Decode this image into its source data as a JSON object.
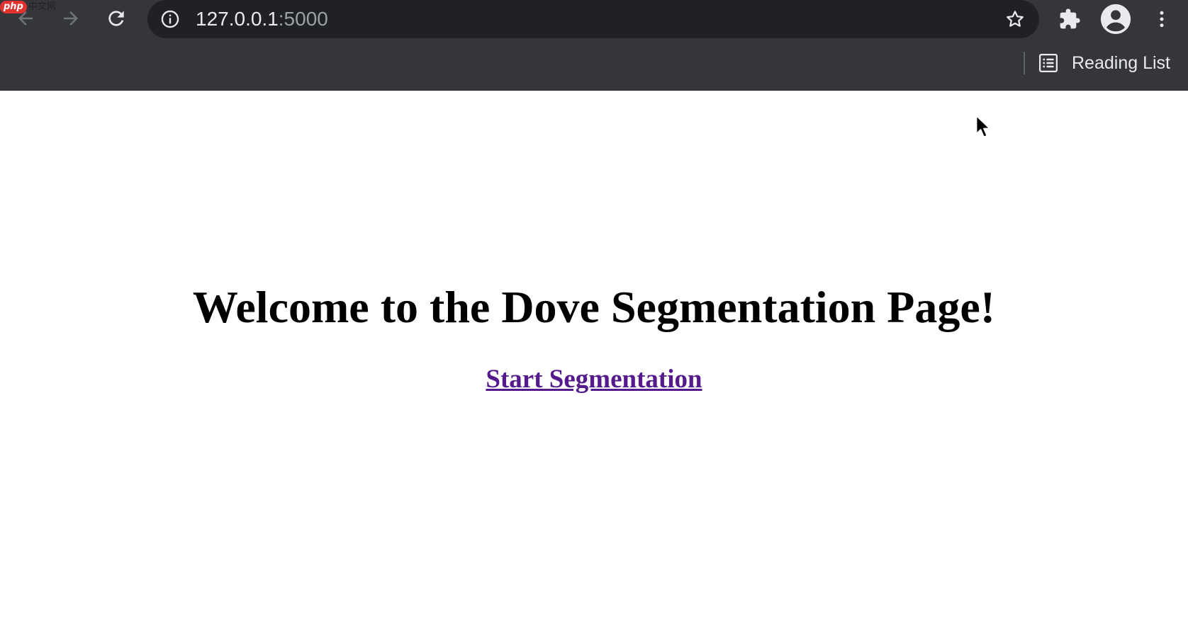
{
  "browser": {
    "url_host": "127.0.0.1",
    "url_port": ":5000",
    "reading_list_label": "Reading List",
    "watermark_badge": "php",
    "watermark_text": "中文网"
  },
  "page": {
    "title": "Welcome to the Dove Segmentation Page!",
    "start_link": "Start Segmentation"
  },
  "colors": {
    "chrome_bg": "#35363a",
    "omnibox_bg": "#202124",
    "link_visited": "#551a8b"
  },
  "icons": {
    "back": "arrow-left-icon",
    "forward": "arrow-right-icon",
    "reload": "reload-icon",
    "site_info": "info-icon",
    "bookmark": "star-icon",
    "extensions": "puzzle-icon",
    "profile": "account-icon",
    "menu": "kebab-menu-icon",
    "reading_list": "reading-list-icon"
  }
}
